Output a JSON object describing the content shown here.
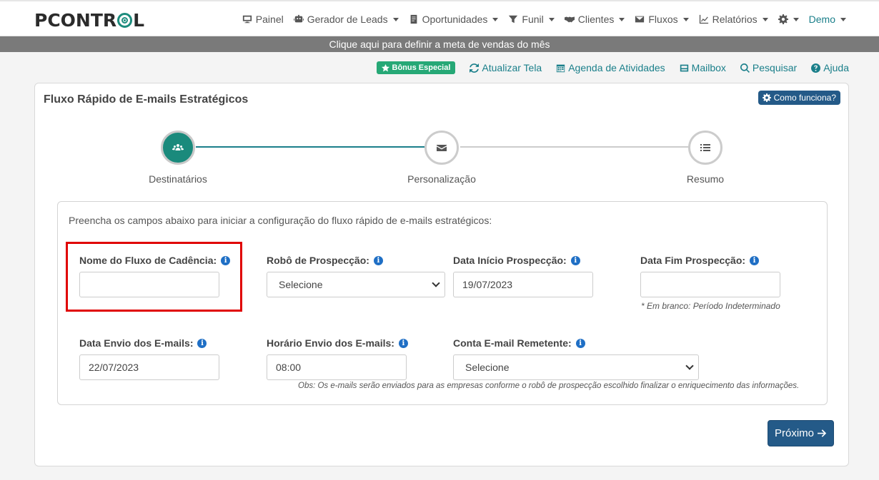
{
  "brand": {
    "logo_text_left": "PCONTR",
    "logo_text_right": "L"
  },
  "nav": {
    "items": [
      {
        "label": "Painel",
        "icon": "monitor-icon",
        "caret": false
      },
      {
        "label": "Gerador de Leads",
        "icon": "robot-icon",
        "caret": true
      },
      {
        "label": "Oportunidades",
        "icon": "document-icon",
        "caret": true
      },
      {
        "label": "Funil",
        "icon": "filter-icon",
        "caret": true
      },
      {
        "label": "Clientes",
        "icon": "handshake-icon",
        "caret": true
      },
      {
        "label": "Fluxos",
        "icon": "envelope-icon",
        "caret": true
      },
      {
        "label": "Relatórios",
        "icon": "line-chart-icon",
        "caret": true
      }
    ],
    "user_label": "Demo"
  },
  "goal_bar": {
    "text": "Clique aqui para definir a meta de vendas do mês"
  },
  "toolbar": {
    "bonus_label": "Bônus Especial",
    "refresh_label": "Atualizar Tela",
    "agenda_label": "Agenda de Atividades",
    "mailbox_label": "Mailbox",
    "search_label": "Pesquisar",
    "help_label": "Ajuda"
  },
  "card": {
    "title": "Fluxo Rápido de E-mails Estratégicos",
    "how_label": "Como funciona?"
  },
  "steps": [
    {
      "label": "Destinatários",
      "icon": "users-icon",
      "active": true
    },
    {
      "label": "Personalização",
      "icon": "envelope-icon",
      "active": false
    },
    {
      "label": "Resumo",
      "icon": "list-icon",
      "active": false
    }
  ],
  "form": {
    "intro": "Preencha os campos abaixo para iniciar a configuração do fluxo rápido de e-mails estratégicos:",
    "flow_name": {
      "label": "Nome do Fluxo de Cadência:",
      "value": ""
    },
    "robot": {
      "label": "Robô de Prospecção:",
      "value": "Selecione"
    },
    "start_date": {
      "label": "Data Início Prospecção:",
      "value": "19/07/2023"
    },
    "end_date": {
      "label": "Data Fim Prospecção:",
      "value": "",
      "hint": "* Em branco: Período Indeterminado"
    },
    "send_date": {
      "label": "Data Envio dos E-mails:",
      "value": "22/07/2023"
    },
    "send_time": {
      "label": "Horário Envio dos E-mails:",
      "value": "08:00"
    },
    "sender": {
      "label": "Conta E-mail Remetente:",
      "value": "Selecione"
    },
    "note": "Obs: Os e-mails serão enviados para as empresas conforme o robô de prospecção escolhido finalizar o enriquecimento das informações."
  },
  "next_label": "Próximo",
  "colors": {
    "accent": "#1a7f8a",
    "primary_button": "#245a88",
    "bonus": "#26a876",
    "highlight": "#e00000"
  }
}
